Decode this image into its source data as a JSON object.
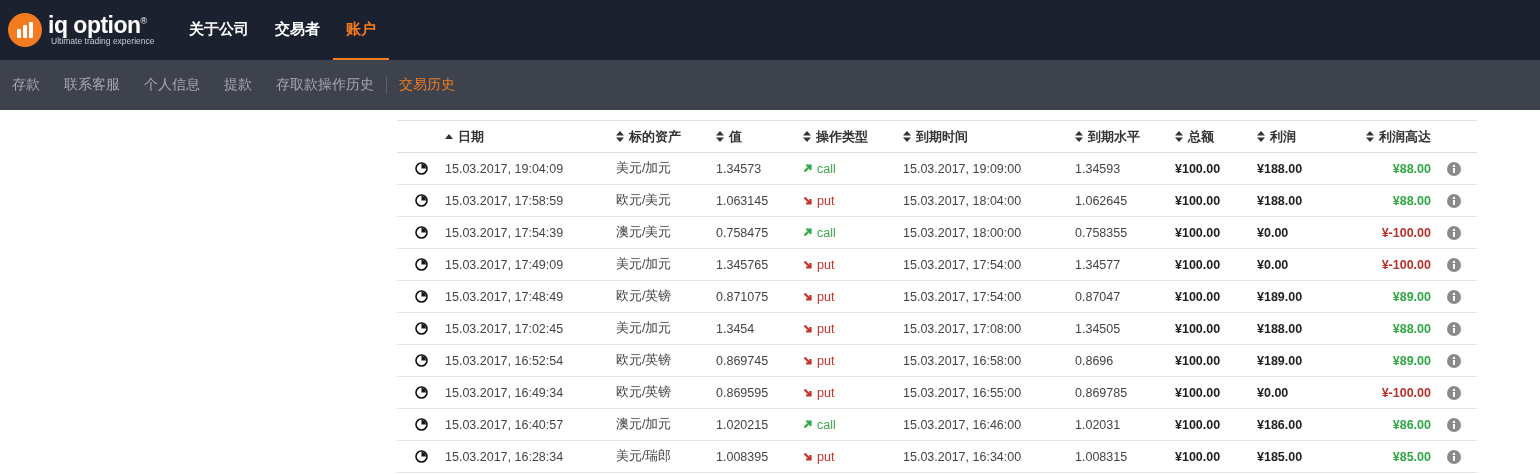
{
  "logo": {
    "name": "iq option",
    "mark": "®",
    "tagline": "Ultimate trading experience"
  },
  "main_nav": [
    {
      "label": "关于公司",
      "selected": false
    },
    {
      "label": "交易者",
      "selected": false
    },
    {
      "label": "账户",
      "selected": true
    }
  ],
  "sub_nav": [
    {
      "label": "存款",
      "selected": false
    },
    {
      "label": "联系客服",
      "selected": false
    },
    {
      "label": "个人信息",
      "selected": false
    },
    {
      "label": "提款",
      "selected": false
    },
    {
      "label": "存取款操作历史",
      "selected": false
    },
    {
      "label": "交易历史",
      "selected": true
    }
  ],
  "table": {
    "columns": [
      {
        "label": "日期",
        "sorted": true
      },
      {
        "label": "标的资产",
        "sorted": false
      },
      {
        "label": "值",
        "sorted": false
      },
      {
        "label": "操作类型",
        "sorted": false
      },
      {
        "label": "到期时间",
        "sorted": false
      },
      {
        "label": "到期水平",
        "sorted": false
      },
      {
        "label": "总额",
        "sorted": false
      },
      {
        "label": "利润",
        "sorted": false
      },
      {
        "label": "利润高达",
        "sorted": false
      }
    ],
    "rows": [
      {
        "date": "15.03.2017, 19:04:09",
        "asset": "美元/加元",
        "value": "1.34573",
        "rising": true,
        "type": "call",
        "expiry": "15.03.2017, 19:09:00",
        "level": "1.34593",
        "total": "¥100.00",
        "profit": "¥188.00",
        "won": true,
        "max_profit": "¥88.00"
      },
      {
        "date": "15.03.2017, 17:58:59",
        "asset": "欧元/美元",
        "value": "1.063145",
        "rising": false,
        "type": "put",
        "expiry": "15.03.2017, 18:04:00",
        "level": "1.062645",
        "total": "¥100.00",
        "profit": "¥188.00",
        "won": true,
        "max_profit": "¥88.00"
      },
      {
        "date": "15.03.2017, 17:54:39",
        "asset": "澳元/美元",
        "value": "0.758475",
        "rising": true,
        "type": "call",
        "expiry": "15.03.2017, 18:00:00",
        "level": "0.758355",
        "total": "¥100.00",
        "profit": "¥0.00",
        "won": false,
        "max_profit": "¥-100.00"
      },
      {
        "date": "15.03.2017, 17:49:09",
        "asset": "美元/加元",
        "value": "1.345765",
        "rising": false,
        "type": "put",
        "expiry": "15.03.2017, 17:54:00",
        "level": "1.34577",
        "total": "¥100.00",
        "profit": "¥0.00",
        "won": false,
        "max_profit": "¥-100.00"
      },
      {
        "date": "15.03.2017, 17:48:49",
        "asset": "欧元/英镑",
        "value": "0.871075",
        "rising": false,
        "type": "put",
        "expiry": "15.03.2017, 17:54:00",
        "level": "0.87047",
        "total": "¥100.00",
        "profit": "¥189.00",
        "won": true,
        "max_profit": "¥89.00"
      },
      {
        "date": "15.03.2017, 17:02:45",
        "asset": "美元/加元",
        "value": "1.3454",
        "rising": false,
        "type": "put",
        "expiry": "15.03.2017, 17:08:00",
        "level": "1.34505",
        "total": "¥100.00",
        "profit": "¥188.00",
        "won": true,
        "max_profit": "¥88.00"
      },
      {
        "date": "15.03.2017, 16:52:54",
        "asset": "欧元/英镑",
        "value": "0.869745",
        "rising": false,
        "type": "put",
        "expiry": "15.03.2017, 16:58:00",
        "level": "0.8696",
        "total": "¥100.00",
        "profit": "¥189.00",
        "won": true,
        "max_profit": "¥89.00"
      },
      {
        "date": "15.03.2017, 16:49:34",
        "asset": "欧元/英镑",
        "value": "0.869595",
        "rising": false,
        "type": "put",
        "expiry": "15.03.2017, 16:55:00",
        "level": "0.869785",
        "total": "¥100.00",
        "profit": "¥0.00",
        "won": false,
        "max_profit": "¥-100.00"
      },
      {
        "date": "15.03.2017, 16:40:57",
        "asset": "澳元/加元",
        "value": "1.020215",
        "rising": true,
        "type": "call",
        "expiry": "15.03.2017, 16:46:00",
        "level": "1.02031",
        "total": "¥100.00",
        "profit": "¥186.00",
        "won": true,
        "max_profit": "¥86.00"
      },
      {
        "date": "15.03.2017, 16:28:34",
        "asset": "美元/瑞郎",
        "value": "1.008395",
        "rising": false,
        "type": "put",
        "expiry": "15.03.2017, 16:34:00",
        "level": "1.008315",
        "total": "¥100.00",
        "profit": "¥185.00",
        "won": true,
        "max_profit": "¥85.00"
      }
    ]
  }
}
